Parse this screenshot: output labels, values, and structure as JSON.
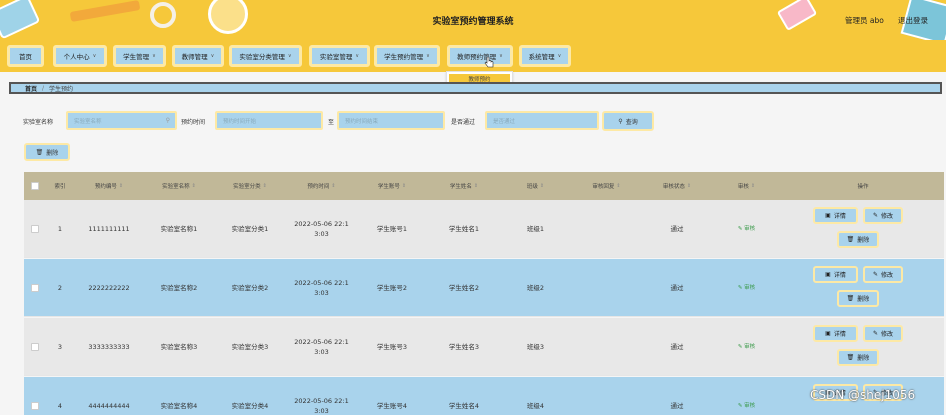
{
  "header": {
    "title": "实验室预约管理系统",
    "user": "管理员 abo",
    "logout": "退出登录",
    "bg_color": "#f6c83a"
  },
  "nav": {
    "items": [
      {
        "label": "首页",
        "has_chevron": false
      },
      {
        "label": "个人中心",
        "has_chevron": true
      },
      {
        "label": "学生管理",
        "has_chevron": true
      },
      {
        "label": "教师管理",
        "has_chevron": true
      },
      {
        "label": "实验室分类管理",
        "has_chevron": true
      },
      {
        "label": "实验室管理",
        "has_chevron": true
      },
      {
        "label": "学生预约管理",
        "has_chevron": true
      },
      {
        "label": "教师预约管理",
        "has_chevron": true
      },
      {
        "label": "系统管理",
        "has_chevron": true
      }
    ],
    "dropdown": {
      "item": "教师预约"
    }
  },
  "breadcrumb": {
    "home": "首页",
    "separator": "/",
    "current": "学生预约"
  },
  "search": {
    "lab_name_label": "实验室名称",
    "lab_name_placeholder": "实验室名称",
    "time_label": "预约时间",
    "start_placeholder": "预约时间开始",
    "to_label": "至",
    "end_placeholder": "预约时间结束",
    "approved_label": "是否通过",
    "approved_placeholder": "是否通过",
    "query_button": "查询"
  },
  "actions": {
    "delete_button": "删除"
  },
  "table": {
    "headers": [
      "索引",
      "预约编号",
      "实验室名称",
      "实验室分类",
      "预约时间",
      "学生账号",
      "学生姓名",
      "班级",
      "审核回复",
      "审核状态",
      "审核",
      "操作"
    ],
    "rows": [
      {
        "index": "1",
        "no": "1111111111",
        "lab": "实验室名称1",
        "category": "实验室分类1",
        "time1": "2022-05-06 22:1",
        "time2": "3:03",
        "account": "学生账号1",
        "name": "学生姓名1",
        "class": "班级1",
        "reply": "",
        "status": "通过",
        "review": "审核"
      },
      {
        "index": "2",
        "no": "2222222222",
        "lab": "实验室名称2",
        "category": "实验室分类2",
        "time1": "2022-05-06 22:1",
        "time2": "3:03",
        "account": "学生账号2",
        "name": "学生姓名2",
        "class": "班级2",
        "reply": "",
        "status": "通过",
        "review": "审核"
      },
      {
        "index": "3",
        "no": "3333333333",
        "lab": "实验室名称3",
        "category": "实验室分类3",
        "time1": "2022-05-06 22:1",
        "time2": "3:03",
        "account": "学生账号3",
        "name": "学生姓名3",
        "class": "班级3",
        "reply": "",
        "status": "通过",
        "review": "审核"
      },
      {
        "index": "4",
        "no": "4444444444",
        "lab": "实验室名称4",
        "category": "实验室分类4",
        "time1": "2022-05-06 22:1",
        "time2": "3:03",
        "account": "学生账号4",
        "name": "学生姓名4",
        "class": "班级4",
        "reply": "",
        "status": "通过",
        "review": "审核"
      }
    ],
    "op_labels": {
      "detail": "详情",
      "edit": "修改",
      "delete": "删除"
    }
  },
  "watermark": "CSDN @shej1056"
}
